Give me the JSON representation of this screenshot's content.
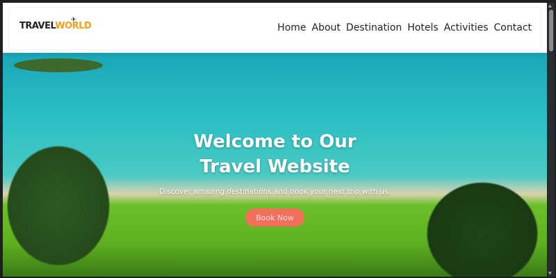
{
  "logo": {
    "text_a": "TRAVEL",
    "text_b": "WORLD"
  },
  "nav": [
    "Home",
    "About",
    "Destination",
    "Hotels",
    "Activities",
    "Contact"
  ],
  "hero": {
    "title": "Welcome to Our Travel Website",
    "subtitle": "Discover amazing destinations and book your next trip with us.",
    "button": "Book Now"
  }
}
